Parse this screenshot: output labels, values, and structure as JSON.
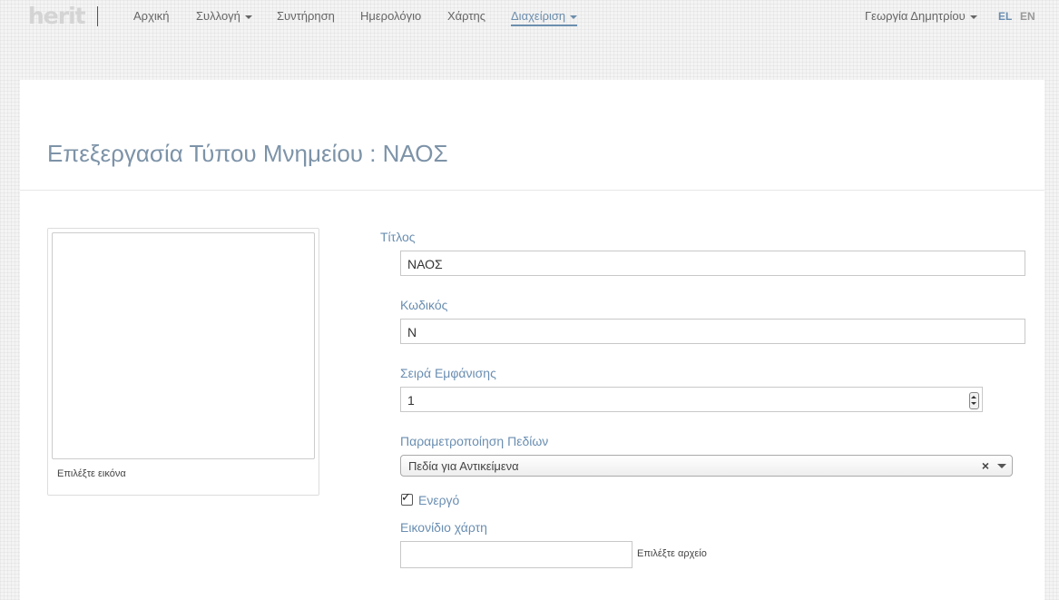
{
  "nav": {
    "logo": "herit",
    "items": [
      "Αρχική",
      "Συλλογή",
      "Συντήρηση",
      "Ημερολόγιο",
      "Χάρτης",
      "Διαχείριση"
    ],
    "user": "Γεωργία Δημητρίου",
    "lang_el": "EL",
    "lang_en": "EN"
  },
  "page": {
    "title": "Επεξεργασία Τύπου Μνημείου : ΝΑΟΣ"
  },
  "image_panel": {
    "caption": "Επιλέξτε εικόνα"
  },
  "form": {
    "title_label": "Τίτλος",
    "title_value": "ΝΑΟΣ",
    "code_label": "Κωδικός",
    "code_value": "N",
    "order_label": "Σειρά Εμφάνισης",
    "order_value": "1",
    "params_label": "Παραμετροποίηση Πεδίων",
    "params_value": "Πεδία για Αντικείμενα",
    "params_clear": "×",
    "active_label": "Ενεργό",
    "active_checked": true,
    "map_icon_label": "Εικονίδιο χάρτη",
    "map_icon_caption": "Επιλέξτε αρχείο"
  },
  "colors": {
    "accent": "#6a8eb1",
    "title": "#7d93a8"
  }
}
